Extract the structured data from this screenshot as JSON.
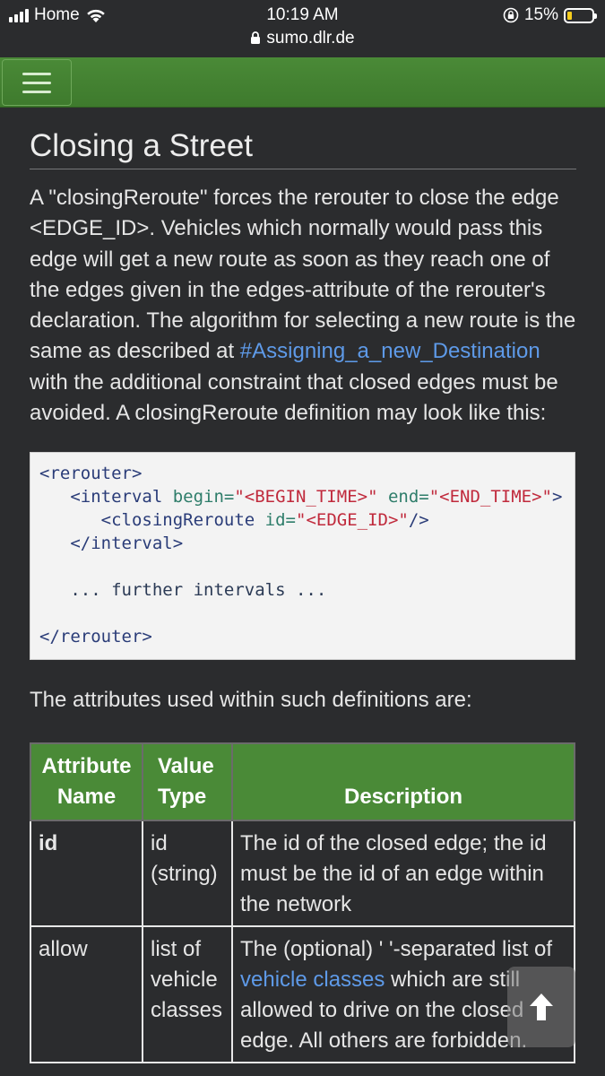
{
  "status": {
    "carrier": "Home",
    "time": "10:19 AM",
    "url": "sumo.dlr.de",
    "battery": "15%"
  },
  "page": {
    "title": "Closing a Street",
    "intro_before_link": "A \"closingReroute\" forces the rerouter to close the edge <EDGE_ID>. Vehicles which normally would pass this edge will get a new route as soon as they reach one of the edges given in the edges-attribute of the rerouter's declaration. The algorithm for selecting a new route is the same as described at ",
    "intro_link": "#Assigning_a_new_Destination",
    "intro_after_link": " with the additional constraint that closed edges must be avoided. A closingReroute definition may look like this:",
    "code": {
      "l1_tag": "<rerouter>",
      "l2_open": "<interval",
      "l2_attr1": " begin=",
      "l2_val1": "\"<BEGIN_TIME>\"",
      "l2_attr2": " end=",
      "l2_val2": "\"<END_TIME>\"",
      "l2_close": ">",
      "l3_open": "<closingReroute",
      "l3_attr": " id=",
      "l3_val": "\"<EDGE_ID>\"",
      "l3_close": "/>",
      "l4_tag": "</interval>",
      "l5_text": "... further intervals ...",
      "l6_tag": "</rerouter>"
    },
    "attributes_intro": "The attributes used within such definitions are:",
    "table": {
      "headers": [
        "Attribute Name",
        "Value Type",
        "Description"
      ],
      "rows": [
        {
          "name": "id",
          "type": "id (string)",
          "desc_before": "The id of the closed edge; the id must be the id of an edge within the network",
          "desc_link": "",
          "desc_after": ""
        },
        {
          "name": "allow",
          "type": "list of vehicle classes",
          "desc_before": "The (optional) ' '-separated list of ",
          "desc_link": "vehicle classes",
          "desc_after": " which are still allowed to drive on the closed edge. All others are forbidden."
        }
      ]
    }
  }
}
